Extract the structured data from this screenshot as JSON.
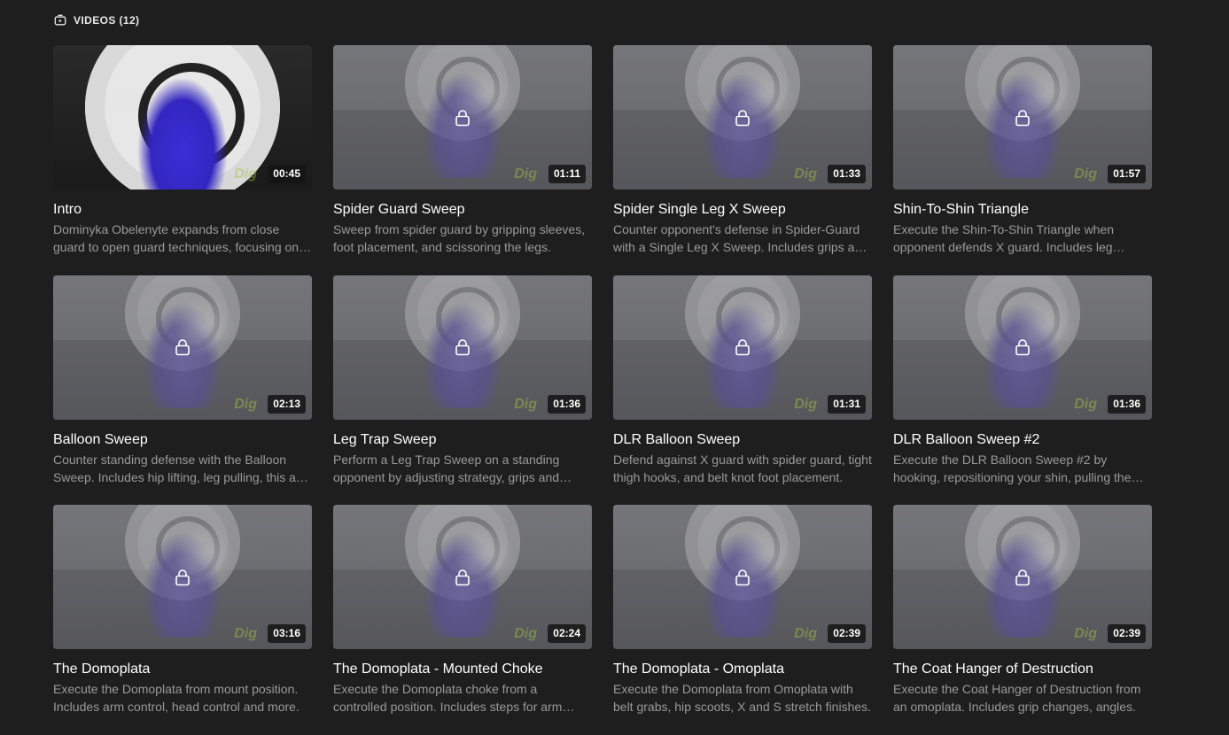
{
  "section": {
    "label": "VIDEOS (12)",
    "icon": "video-icon"
  },
  "brand_mark": "Dig",
  "videos": [
    {
      "title": "Intro",
      "duration": "00:45",
      "locked": false,
      "description": "Dominyka Obelenyte expands from close guard to open guard techniques, focusing on transitions and control."
    },
    {
      "title": "Spider Guard Sweep",
      "duration": "01:11",
      "locked": true,
      "description": "Sweep from spider guard by gripping sleeves, foot placement, and scissoring the legs."
    },
    {
      "title": "Spider Single Leg X Sweep",
      "duration": "01:33",
      "locked": true,
      "description": "Counter opponent's defense in Spider-Guard with a Single Leg X Sweep. Includes grips and angles."
    },
    {
      "title": "Shin-To-Shin Triangle",
      "duration": "01:57",
      "locked": true,
      "description": "Execute the Shin-To-Shin Triangle when opponent defends X guard. Includes leg positioning."
    },
    {
      "title": "Balloon Sweep",
      "duration": "02:13",
      "locked": true,
      "description": "Counter standing defense with the Balloon Sweep. Includes hip lifting, leg pulling, this and more."
    },
    {
      "title": "Leg Trap Sweep",
      "duration": "01:36",
      "locked": true,
      "description": "Perform a Leg Trap Sweep on a standing opponent by adjusting strategy, grips and balance."
    },
    {
      "title": "DLR Balloon Sweep",
      "duration": "01:31",
      "locked": true,
      "description": "Defend against X guard with spider guard, tight thigh hooks, and belt knot foot placement."
    },
    {
      "title": "DLR Balloon Sweep #2",
      "duration": "01:36",
      "locked": true,
      "description": "Execute the DLR Balloon Sweep #2 by hooking, repositioning your shin, pulling the sleeve."
    },
    {
      "title": "The Domoplata",
      "duration": "03:16",
      "locked": true,
      "description": "Execute the Domoplata from mount position. Includes arm control, head control and more."
    },
    {
      "title": "The Domoplata - Mounted Choke",
      "duration": "02:24",
      "locked": true,
      "description": "Execute the Domoplata choke from a controlled position. Includes steps for arm control."
    },
    {
      "title": "The Domoplata - Omoplata",
      "duration": "02:39",
      "locked": true,
      "description": "Execute the Domoplata from Omoplata with belt grabs, hip scoots, X and S stretch finishes."
    },
    {
      "title": "The Coat Hanger of Destruction",
      "duration": "02:39",
      "locked": true,
      "description": "Execute the Coat Hanger of Destruction from an omoplata. Includes grip changes, angles."
    }
  ]
}
